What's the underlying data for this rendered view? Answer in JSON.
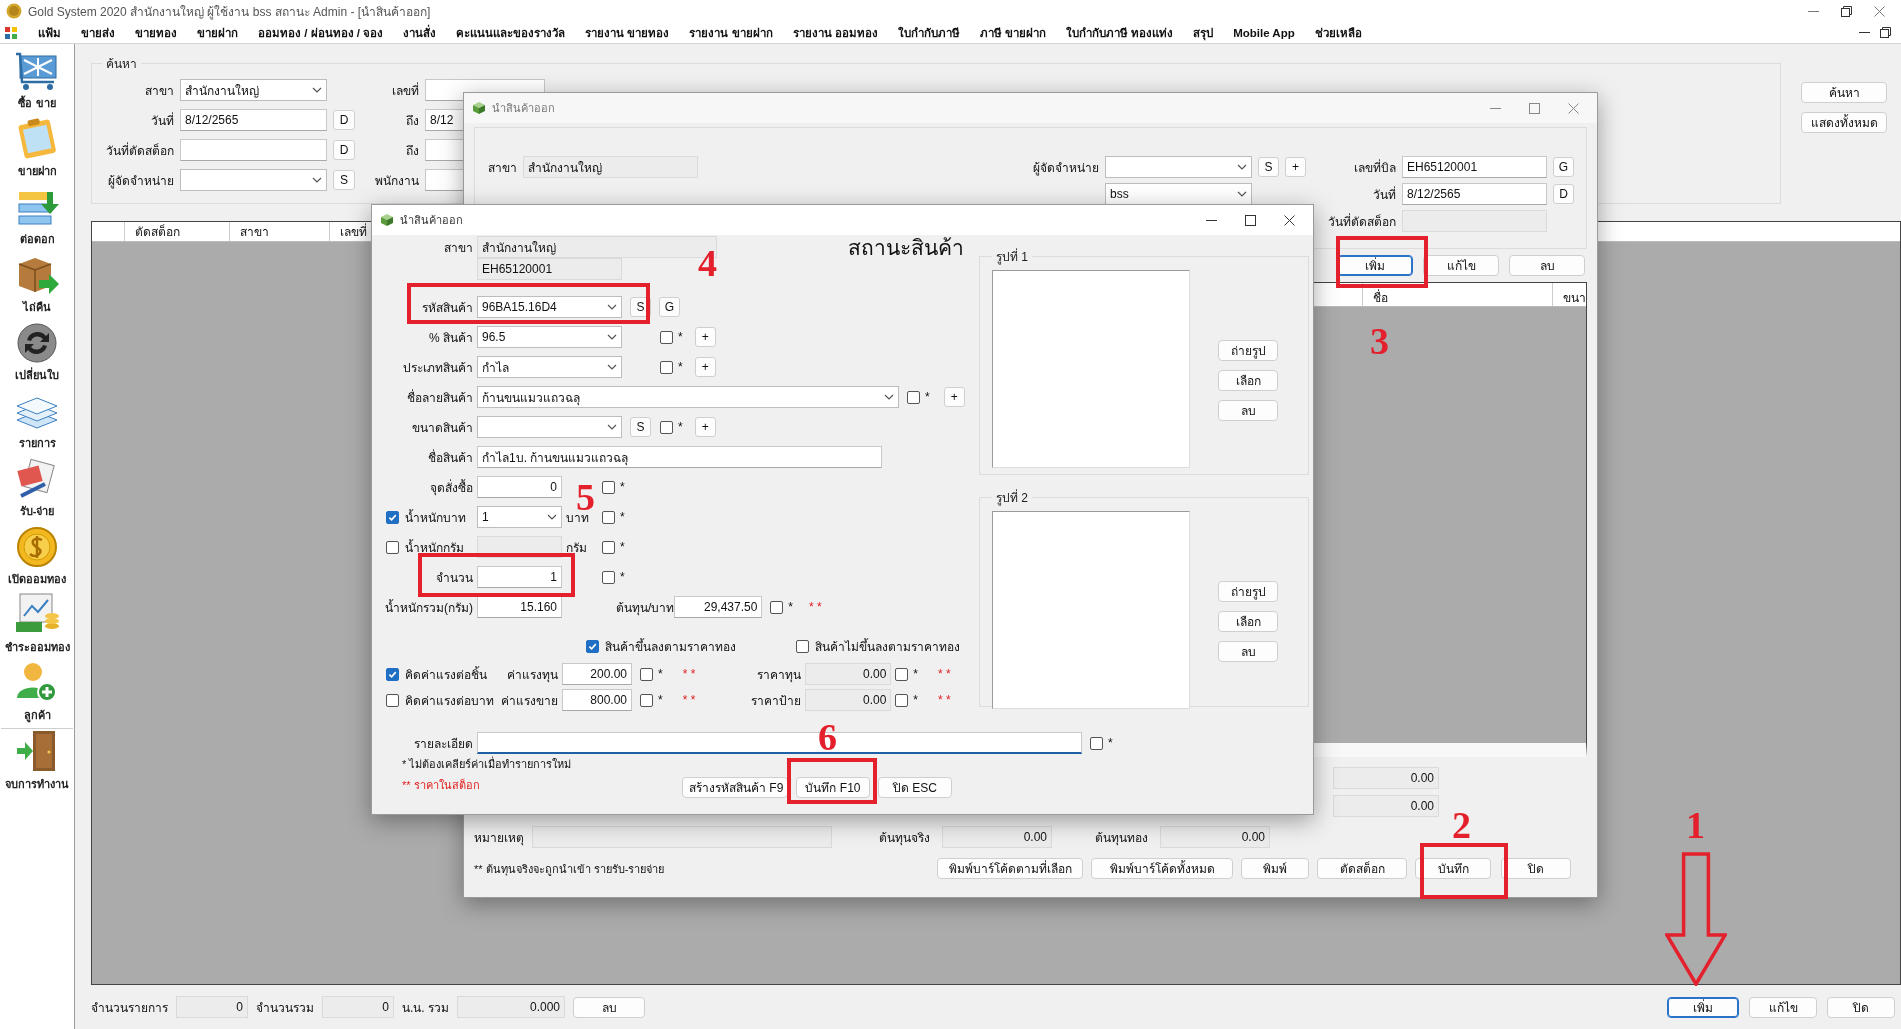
{
  "app": {
    "title": "Gold System 2020  สำนักงานใหญ่ ผู้ใช้งาน bss สถานะ Admin - [นำสินค้าออก]"
  },
  "menu": [
    "แฟ้ม",
    "ขายส่ง",
    "ขายทอง",
    "ขายฝาก",
    "ออมทอง / ผ่อนทอง / จอง",
    "งานสั่ง",
    "คะแนนและของรางวัล",
    "รายงาน ขายทอง",
    "รายงาน ขายฝาก",
    "รายงาน ออมทอง",
    "ใบกำกับภาษี",
    "ภาษี ขายฝาก",
    "ใบกำกับภาษี ทองแท่ง",
    "สรุป",
    "Mobile App",
    "ช่วยเหลือ"
  ],
  "sidebar": [
    "ซื้อ ขาย",
    "ขายฝาก",
    "ต่อดอก",
    "ไถ่คืน",
    "เปลี่ยนใบ",
    "รายการ",
    "รับ-จ่าย",
    "เปิดออมทอง",
    "ชำระออมทอง",
    "ลูกค้า",
    "จบการทำงาน"
  ],
  "search": {
    "title": "ค้นหา",
    "left": [
      {
        "kind": "combo",
        "label": "สาขา",
        "value": "สำนักงานใหญ่"
      },
      {
        "kind": "field",
        "label": "วันที่",
        "value": "8/12/2565",
        "button": "D"
      },
      {
        "kind": "field",
        "label": "วันที่ตัดสต็อก",
        "button": "D"
      },
      {
        "kind": "combo",
        "label": "ผู้จัดจำหน่าย",
        "button": "S"
      }
    ],
    "middle": [
      {
        "label": "เลขที่"
      },
      {
        "label": "ถึง",
        "value": "8/12"
      },
      {
        "label": "ถึง"
      },
      {
        "label": "พนักงาน"
      }
    ],
    "buttons": [
      "ค้นหา",
      "แสดงทั้งหมด"
    ]
  },
  "grid": {
    "columns": [
      "ตัดสต็อก",
      "สาขา",
      "เลขที่"
    ]
  },
  "footer": {
    "stats": [
      {
        "label": "จำนวนรายการ",
        "value": "0"
      },
      {
        "label": "จำนวนรวม",
        "value": "0"
      },
      {
        "label": "น.น. รวม",
        "value": "0.000"
      }
    ],
    "delete": "ลบ",
    "buttons": [
      "เพิ่ม",
      "แก้ไข",
      "ปิด"
    ]
  },
  "stock_window": {
    "title": "นำสินค้าออก",
    "branch": {
      "label": "สาขา",
      "value": "สำนักงานใหญ่"
    },
    "supplier": {
      "label": "ผู้จัดจำหน่าย",
      "buttons": [
        "S",
        "+"
      ]
    },
    "bill": {
      "label": "เลขที่บิล",
      "value": "EH65120001",
      "button": "G"
    },
    "staff": {
      "value": "bss"
    },
    "date": {
      "label": "วันที่",
      "value": "8/12/2565",
      "button": "D"
    },
    "cut_date": {
      "label": "วันที่ตัดสต็อก"
    },
    "actions": [
      {
        "label": "เพิ่ม",
        "focused": true
      },
      {
        "label": "แก้ไข",
        "focused": false
      },
      {
        "label": "ลบ",
        "focused": false
      }
    ],
    "columns": [
      "ชื่อ",
      "ขนา"
    ],
    "totals": [
      "0.00",
      "0.00"
    ],
    "remark": {
      "label": "หมายเหตุ"
    },
    "costs": [
      {
        "label": "ต้นทุนจริง",
        "value": "0.00"
      },
      {
        "label": "ต้นทุนทอง",
        "value": "0.00"
      }
    ],
    "note": "** ต้นทุนจริงจะถูกนำเข้า รายรับ-รายจ่าย",
    "buttons": [
      "พิมพ์บาร์โค้ดตามที่เลือก",
      "พิมพ์บาร์โค้ดทั้งหมด",
      "พิมพ์",
      "ตัดสต็อก",
      "บันทึก",
      "ปิด"
    ]
  },
  "product_window": {
    "title": "นำสินค้าออก",
    "heading": "สถานะสินค้า",
    "rows": [
      {
        "kind": "readonly",
        "label": "สาขา",
        "value": "สำนักงานใหญ่"
      },
      {
        "kind": "readonly-short",
        "value": "EH65120001"
      },
      {
        "kind": "combo",
        "label": "รหัสสินค้า",
        "value": "96BA15.16D4",
        "buttons": [
          "S",
          "G"
        ]
      },
      {
        "kind": "combo",
        "label": "% สินค้า",
        "value": "96.5",
        "check": {
          "checked": false,
          "note": "*"
        },
        "add": "+"
      },
      {
        "kind": "combo",
        "label": "ประเภทสินค้า",
        "value": "กำไล",
        "check": {
          "checked": false,
          "note": "*"
        },
        "add": "+"
      },
      {
        "kind": "combo-wide",
        "label": "ชื่อลายสินค้า",
        "value": "ก้านขนแมวแถวฉลุ",
        "check": {
          "checked": false,
          "note": "*"
        },
        "add": "+"
      },
      {
        "kind": "combo",
        "label": "ขนาดสินค้า",
        "buttons": [
          "S"
        ],
        "check": {
          "checked": false,
          "note": "*"
        },
        "add": "+"
      },
      {
        "kind": "input-wide",
        "label": "ชื่อสินค้า",
        "value": "กำไล1บ. ก้านขนแมวแถวฉลุ"
      },
      {
        "kind": "input",
        "label": "จุดสั่งซื้อ",
        "value": "0",
        "check": {
          "checked": false,
          "note": "*"
        }
      },
      {
        "kind": "combo-short",
        "label": "น้ำหนักบาท",
        "toggle": true,
        "value": "1",
        "unit": "บาท",
        "check": {
          "checked": false,
          "note": "*"
        }
      },
      {
        "kind": "input-off",
        "label": "น้ำหนักกรัม",
        "toggle": false,
        "unit": "กรัม",
        "check": {
          "checked": false,
          "note": "*"
        }
      },
      {
        "kind": "input",
        "label": "จำนวน",
        "value": "1",
        "check": {
          "checked": false,
          "note": "*"
        }
      },
      {
        "kind": "input",
        "label": "น้ำหนักรวม(กรัม)",
        "value": "15.160",
        "extra": {
          "label": "ต้นทุน/บาท",
          "value": "29,437.50",
          "check": {
            "checked": false,
            "note": "*"
          },
          "stock": "* *"
        }
      }
    ],
    "price_modes": [
      {
        "label": "สินค้าขึ้นลงตามราคาทอง",
        "checked": true
      },
      {
        "label": "สินค้าไม่ขึ้นลงตามราคาทอง",
        "checked": false
      }
    ],
    "labor": [
      {
        "label": "คิดค่าแรงต่อชิ้น",
        "checked": true,
        "fee_label": "ค่าแรงทุน",
        "fee": "200.00",
        "fee_check": {
          "checked": false,
          "note": "*"
        },
        "fee_stock": "* *",
        "price_label": "ราคาทุน",
        "price": "0.00",
        "price_check": {
          "checked": false,
          "note": "*"
        },
        "price_stock": "* *"
      },
      {
        "label": "คิดค่าแรงต่อบาท",
        "checked": false,
        "fee_label": "ค่าแรงขาย",
        "fee": "800.00",
        "fee_check": {
          "checked": false,
          "note": "*"
        },
        "fee_stock": "* *",
        "price_label": "ราคาป้าย",
        "price": "0.00",
        "price_check": {
          "checked": false,
          "note": "*"
        },
        "price_stock": "* *"
      }
    ],
    "detail": {
      "label": "รายละเอียด",
      "check": {
        "checked": false,
        "note": "*"
      }
    },
    "notes": [
      {
        "kind": "plain",
        "text": "* ไม่ต้องเคลียร์ค่าเมื่อทำรายการใหม่"
      },
      {
        "kind": "stock",
        "text": "** ราคาในสต็อก"
      }
    ],
    "buttons": [
      "สร้างรหัสสินค้า F9",
      "บันทึก F10",
      "ปิด ESC"
    ],
    "pictures": [
      {
        "title": "รูปที่ 1",
        "buttons": [
          "ถ่ายรูป",
          "เลือก",
          "ลบ"
        ]
      },
      {
        "title": "รูปที่ 2",
        "buttons": [
          "ถ่ายรูป",
          "เลือก",
          "ลบ"
        ]
      }
    ]
  },
  "annotations": [
    {
      "kind": "arrow",
      "number": "1"
    },
    {
      "kind": "box",
      "number": "2"
    },
    {
      "kind": "box",
      "number": "3"
    },
    {
      "kind": "box",
      "number": "4"
    },
    {
      "kind": "box",
      "number": "5"
    },
    {
      "kind": "box",
      "number": "6"
    }
  ]
}
